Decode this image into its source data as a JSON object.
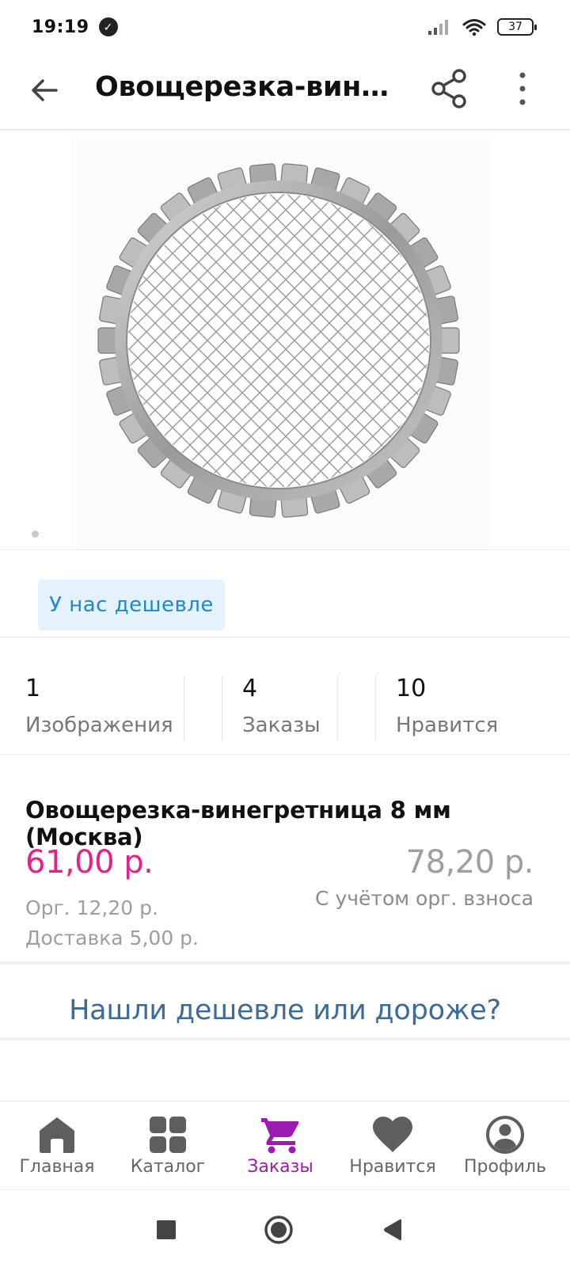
{
  "status_bar": {
    "time": "19:19",
    "battery": "37"
  },
  "app_bar": {
    "title": "Овощерезка-винег..."
  },
  "product_image": {
    "alt": "Овощерезка-винегретница",
    "image_count_dots": 1
  },
  "badge": {
    "label": "У нас дешевле"
  },
  "stats": [
    {
      "value": "1",
      "label": "Изображения"
    },
    {
      "value": "4",
      "label": "Заказы"
    },
    {
      "value": "10",
      "label": "Нравится"
    }
  ],
  "product": {
    "name": "Овощерезка-винегретница 8 мм (Москва)",
    "price": "61,00 р.",
    "price_total": "78,20 р.",
    "price_total_note": "С учётом орг. взноса",
    "org_fee": "Орг. 12,20 р.",
    "delivery": "Доставка 5,00 р."
  },
  "found_cheaper": {
    "label": "Нашли дешевле или дороже?"
  },
  "bottom_nav": [
    {
      "label": "Главная",
      "icon": "home-icon",
      "active": false
    },
    {
      "label": "Каталог",
      "icon": "grid-icon",
      "active": false
    },
    {
      "label": "Заказы",
      "icon": "cart-icon",
      "active": true
    },
    {
      "label": "Нравится",
      "icon": "heart-icon",
      "active": false
    },
    {
      "label": "Профиль",
      "icon": "profile-icon",
      "active": false
    }
  ],
  "colors": {
    "price": "#e8208a",
    "accent_active": "#9c1bb0",
    "link": "#3c6a99",
    "badge_bg": "#e3f2fc",
    "badge_text": "#1e88d0"
  }
}
